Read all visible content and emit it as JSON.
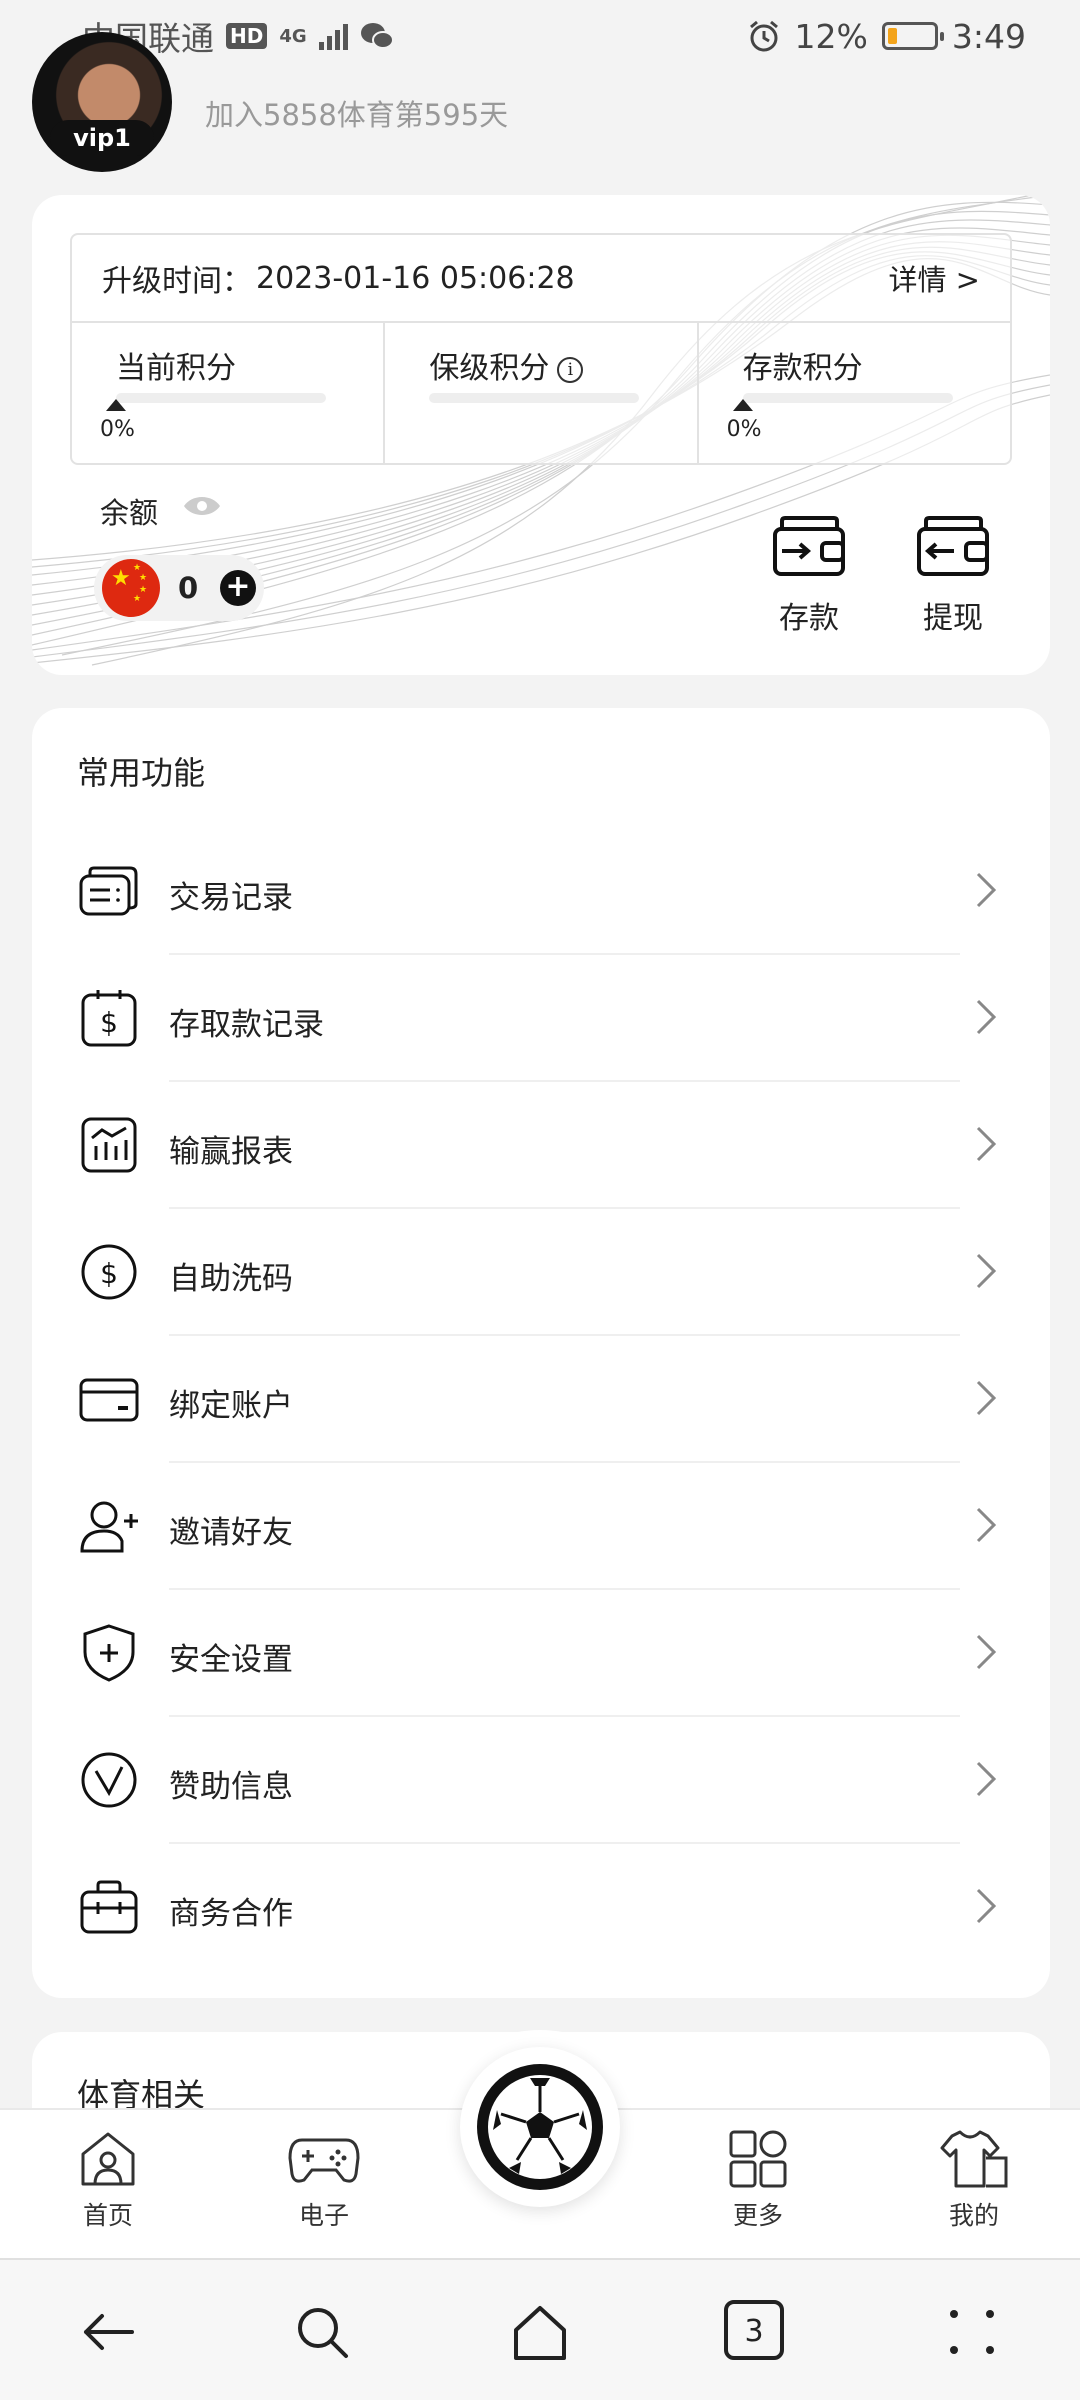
{
  "status_bar": {
    "carrier": "中国联通",
    "hd": "HD",
    "network": "4G",
    "battery_percent": "12%",
    "battery_level": 0.12,
    "time": "3:49"
  },
  "profile": {
    "vip_badge": "vip1",
    "join_text": "加入5858体育第595天"
  },
  "level": {
    "upgrade_label": "升级时间：",
    "upgrade_time": "2023-01-16 05:06:28",
    "detail_link": "详情 >",
    "points": [
      {
        "label": "当前积分",
        "percent": "0%",
        "progress": 0
      },
      {
        "label": "保级积分",
        "percent": "",
        "progress": 0
      },
      {
        "label": "存款积分",
        "percent": "0%",
        "progress": 0
      }
    ]
  },
  "balance": {
    "label": "余额",
    "value": "0"
  },
  "wallet_actions": {
    "deposit": "存款",
    "withdraw": "提现"
  },
  "functions": {
    "title": "常用功能",
    "items": [
      {
        "label": "交易记录",
        "icon": "transaction-icon"
      },
      {
        "label": "存取款记录",
        "icon": "deposit-record-icon"
      },
      {
        "label": "输赢报表",
        "icon": "report-icon"
      },
      {
        "label": "自助洗码",
        "icon": "rebate-icon"
      },
      {
        "label": "绑定账户",
        "icon": "card-icon"
      },
      {
        "label": "邀请好友",
        "icon": "add-user-icon"
      },
      {
        "label": "安全设置",
        "icon": "shield-icon"
      },
      {
        "label": "赞助信息",
        "icon": "sponsor-icon"
      },
      {
        "label": "商务合作",
        "icon": "briefcase-icon"
      }
    ]
  },
  "sports": {
    "title": "体育相关"
  },
  "tabbar": {
    "home": "首页",
    "electronic": "电子",
    "more": "更多",
    "mine": "我的"
  },
  "system_nav": {
    "tab_count": "3"
  }
}
